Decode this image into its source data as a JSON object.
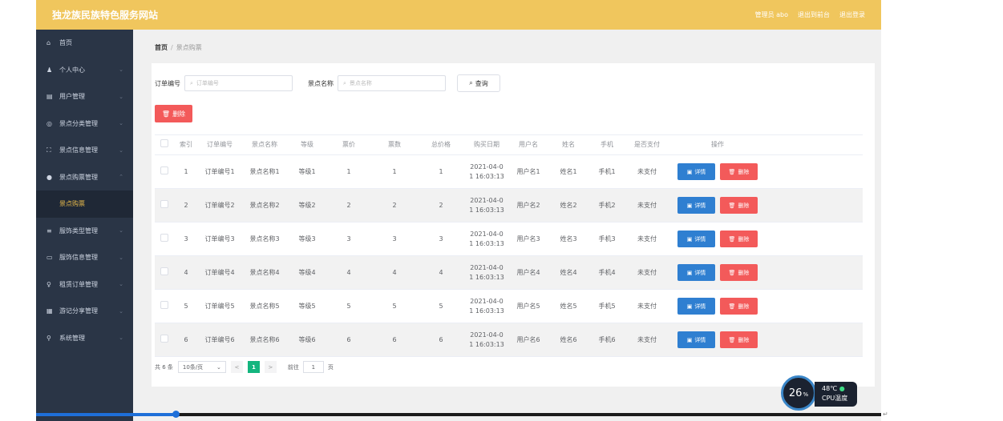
{
  "header": {
    "title": "独龙族民族特色服务网站",
    "links": [
      "管理员 abo",
      "退出到前台",
      "退出登录"
    ]
  },
  "sidebar": {
    "items": [
      {
        "label": "首页",
        "icon": "⌂",
        "has_chevron": false
      },
      {
        "label": "个人中心",
        "icon": "♟",
        "has_chevron": true,
        "chevron": "⌄"
      },
      {
        "label": "用户管理",
        "icon": "▤",
        "has_chevron": true,
        "chevron": "⌄"
      },
      {
        "label": "景点分类管理",
        "icon": "◎",
        "has_chevron": true,
        "chevron": "⌄"
      },
      {
        "label": "景点信息管理",
        "icon": "⛶",
        "has_chevron": true,
        "chevron": "⌄"
      },
      {
        "label": "景点购票管理",
        "icon": "●",
        "has_chevron": true,
        "chevron": "⌃"
      },
      {
        "label": "景点购票",
        "icon": "",
        "has_chevron": false,
        "sub": true
      },
      {
        "label": "服饰类型管理",
        "icon": "≡",
        "has_chevron": true,
        "chevron": "⌄"
      },
      {
        "label": "服饰信息管理",
        "icon": "▭",
        "has_chevron": true,
        "chevron": "⌄"
      },
      {
        "label": "租赁订单管理",
        "icon": "♀",
        "has_chevron": true,
        "chevron": "⌄"
      },
      {
        "label": "游记分享管理",
        "icon": "▦",
        "has_chevron": true,
        "chevron": "⌄"
      },
      {
        "label": "系统管理",
        "icon": "⚲",
        "has_chevron": true,
        "chevron": "⌄"
      }
    ]
  },
  "breadcrumb": {
    "home": "首页",
    "separator": "/",
    "current": "景点购票"
  },
  "filters": {
    "order_label": "订单编号",
    "order_placeholder": "订单编号",
    "spot_label": "景点名称",
    "spot_placeholder": "景点名称",
    "query_label": "查询",
    "query_icon": "⌕"
  },
  "delete_top_label": "删除",
  "table": {
    "headers": [
      "索引",
      "订单编号",
      "景点名称",
      "等级",
      "票价",
      "票数",
      "总价格",
      "购买日期",
      "用户名",
      "姓名",
      "手机",
      "是否支付",
      "操作"
    ],
    "detail_label": "详情",
    "delete_label": "删除",
    "rows": [
      {
        "idx": "1",
        "order": "订单编号1",
        "spot": "景点名称1",
        "level": "等级1",
        "price": "1",
        "count": "1",
        "total": "1",
        "date1": "2021-04-0",
        "date2": "1 16:03:13",
        "user": "用户名1",
        "name": "姓名1",
        "phone": "手机1",
        "paid": "未支付"
      },
      {
        "idx": "2",
        "order": "订单编号2",
        "spot": "景点名称2",
        "level": "等级2",
        "price": "2",
        "count": "2",
        "total": "2",
        "date1": "2021-04-0",
        "date2": "1 16:03:13",
        "user": "用户名2",
        "name": "姓名2",
        "phone": "手机2",
        "paid": "未支付"
      },
      {
        "idx": "3",
        "order": "订单编号3",
        "spot": "景点名称3",
        "level": "等级3",
        "price": "3",
        "count": "3",
        "total": "3",
        "date1": "2021-04-0",
        "date2": "1 16:03:13",
        "user": "用户名3",
        "name": "姓名3",
        "phone": "手机3",
        "paid": "未支付"
      },
      {
        "idx": "4",
        "order": "订单编号4",
        "spot": "景点名称4",
        "level": "等级4",
        "price": "4",
        "count": "4",
        "total": "4",
        "date1": "2021-04-0",
        "date2": "1 16:03:13",
        "user": "用户名4",
        "name": "姓名4",
        "phone": "手机4",
        "paid": "未支付"
      },
      {
        "idx": "5",
        "order": "订单编号5",
        "spot": "景点名称5",
        "level": "等级5",
        "price": "5",
        "count": "5",
        "total": "5",
        "date1": "2021-04-0",
        "date2": "1 16:03:13",
        "user": "用户名5",
        "name": "姓名5",
        "phone": "手机5",
        "paid": "未支付"
      },
      {
        "idx": "6",
        "order": "订单编号6",
        "spot": "景点名称6",
        "level": "等级6",
        "price": "6",
        "count": "6",
        "total": "6",
        "date1": "2021-04-0",
        "date2": "1 16:03:13",
        "user": "用户名6",
        "name": "姓名6",
        "phone": "手机6",
        "paid": "未支付"
      }
    ]
  },
  "pagination": {
    "total": "共 6 条",
    "page_size": "10条/页",
    "prev": "<",
    "current": "1",
    "next": ">",
    "goto_label": "前往",
    "goto_value": "1",
    "goto_suffix": "页"
  },
  "cpu_widget": {
    "usage": "26",
    "usage_unit": "%",
    "temp": "48℃",
    "label": "CPU温度"
  },
  "video_progress": 0.165,
  "colors": {
    "header": "#f0c65d",
    "sidebar": "#2a3546",
    "active_sub": "#e6b94b",
    "primary": "#2f7fd1",
    "danger": "#f35a5a",
    "page_active": "#13b57e"
  }
}
